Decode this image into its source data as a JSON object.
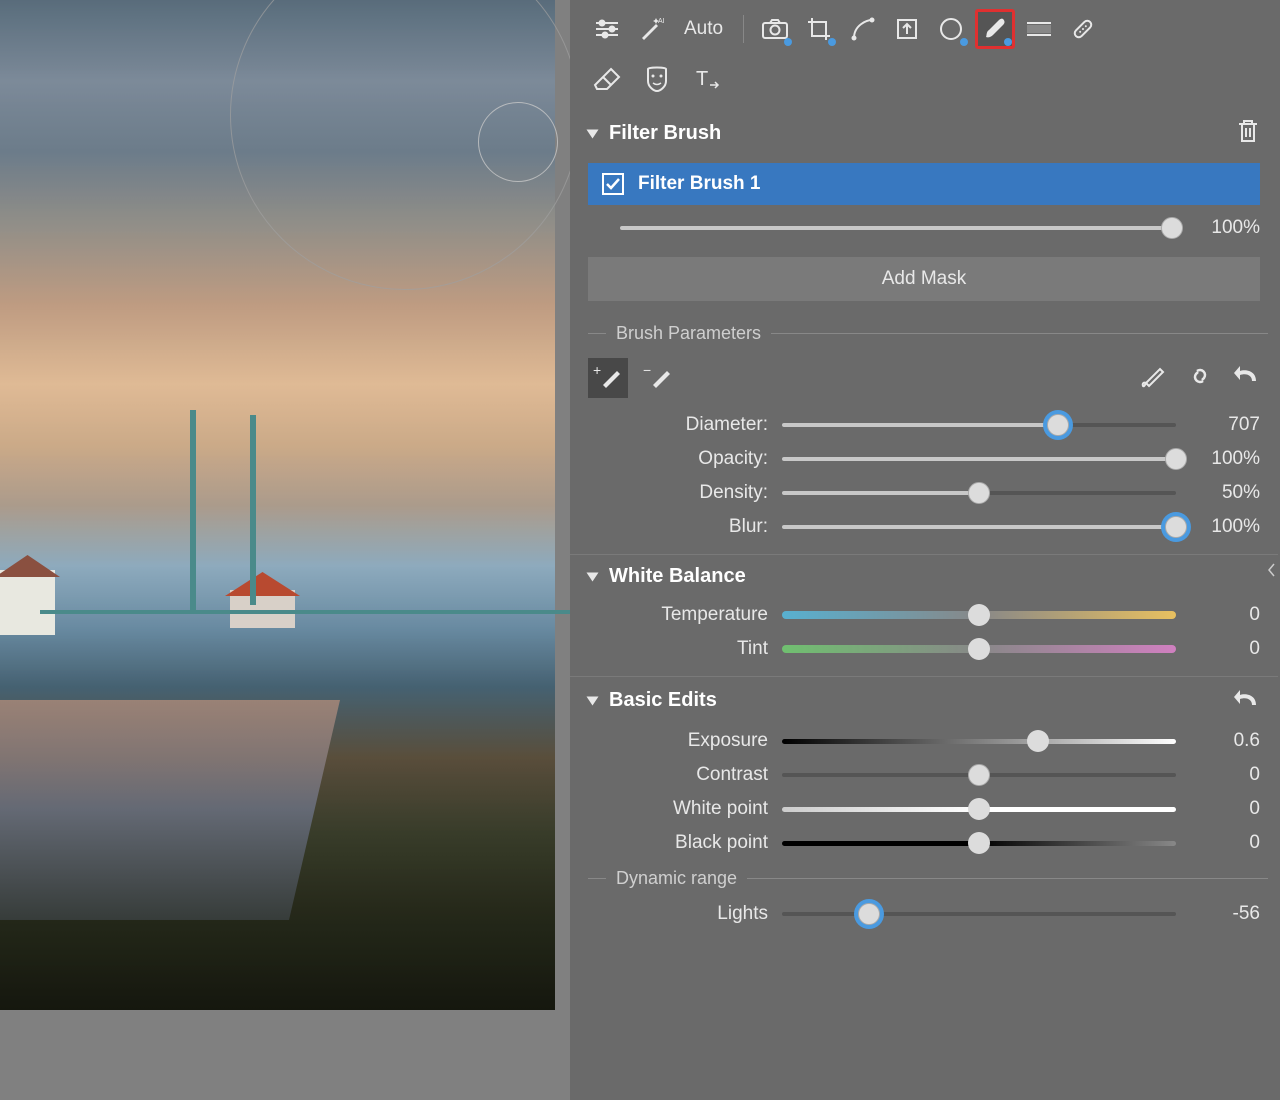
{
  "toolbar": {
    "auto_label": "Auto"
  },
  "filter_brush": {
    "section_title": "Filter Brush",
    "layer_name": "Filter Brush 1",
    "layer_opacity": 100,
    "layer_opacity_text": "100%",
    "add_mask_label": "Add Mask"
  },
  "brush_params": {
    "group_label": "Brush Parameters",
    "diameter_label": "Diameter:",
    "diameter": 707,
    "diameter_pct": 70,
    "opacity_label": "Opacity:",
    "opacity": 100,
    "opacity_text": "100%",
    "density_label": "Density:",
    "density": 50,
    "density_text": "50%",
    "blur_label": "Blur:",
    "blur": 100,
    "blur_text": "100%"
  },
  "white_balance": {
    "section_title": "White Balance",
    "temperature_label": "Temperature",
    "temperature": 0,
    "tint_label": "Tint",
    "tint": 0
  },
  "basic_edits": {
    "section_title": "Basic Edits",
    "exposure_label": "Exposure",
    "exposure": 0.6,
    "exposure_pct": 65,
    "contrast_label": "Contrast",
    "contrast": 0,
    "white_point_label": "White point",
    "white_point": 0,
    "black_point_label": "Black point",
    "black_point": 0,
    "dynamic_range_label": "Dynamic range",
    "lights_label": "Lights",
    "lights": -56,
    "lights_pct": 22
  }
}
